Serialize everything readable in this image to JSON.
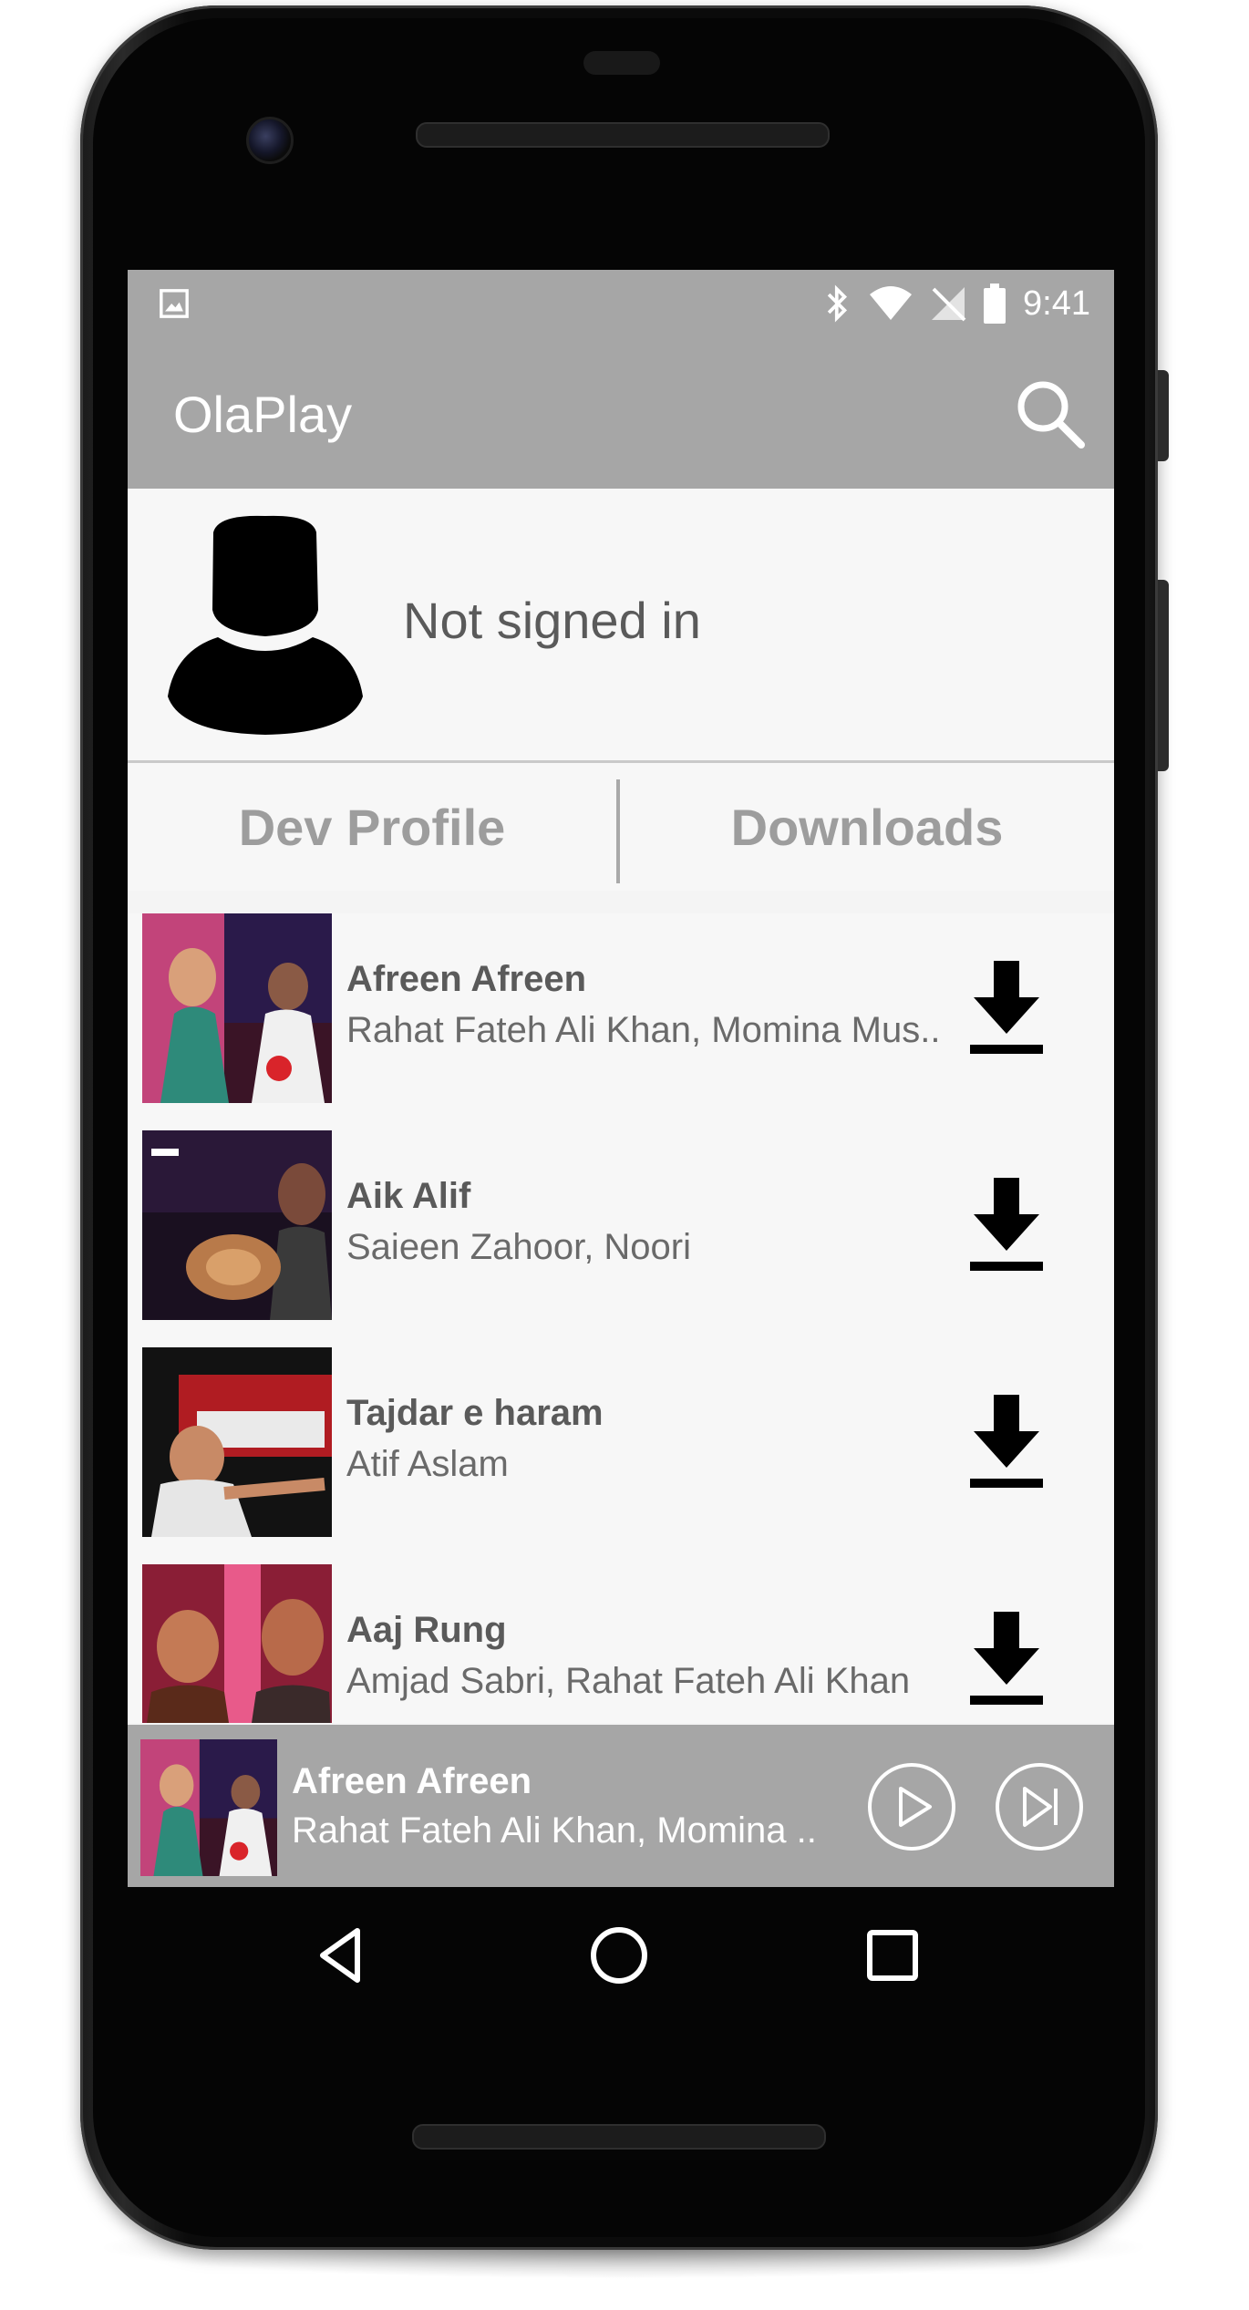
{
  "status_bar": {
    "time": "9:41",
    "icons": [
      "image-icon",
      "bluetooth-icon",
      "wifi-icon",
      "no-signal-icon",
      "battery-icon"
    ]
  },
  "app_bar": {
    "title": "OlaPlay",
    "search_icon": "search-icon"
  },
  "profile": {
    "status_text": "Not signed in",
    "avatar_icon": "person-silhouette-icon"
  },
  "tabs": [
    {
      "label": "Dev Profile"
    },
    {
      "label": "Downloads"
    }
  ],
  "songs": [
    {
      "title": "Afreen Afreen",
      "artist": "Rahat Fateh Ali Khan, Momina Mus.."
    },
    {
      "title": "Aik Alif",
      "artist": "Saieen Zahoor, Noori"
    },
    {
      "title": "Tajdar e haram",
      "artist": "Atif Aslam"
    },
    {
      "title": "Aaj Rung",
      "artist": "Amjad Sabri,  Rahat Fateh Ali Khan"
    }
  ],
  "now_playing": {
    "title": "Afreen Afreen",
    "artist": "Rahat Fateh Ali Khan, Momina .."
  },
  "colors": {
    "app_bar": "#a6a6a6",
    "background": "#f4f4f4",
    "text_primary": "#5a5a5a"
  }
}
